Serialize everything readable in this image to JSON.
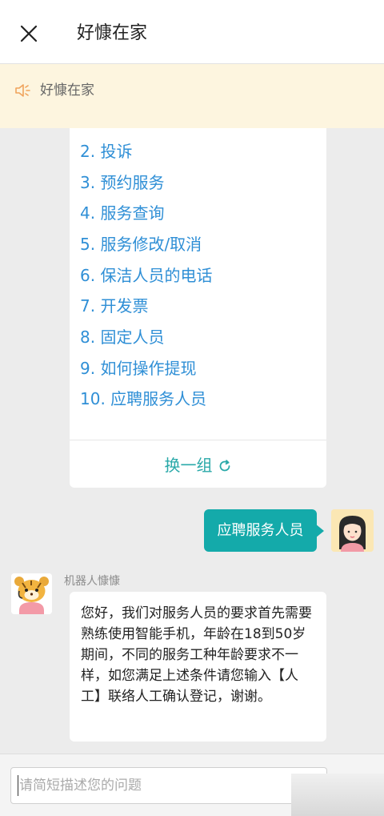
{
  "header": {
    "title": "好慷在家",
    "close_icon": "close-icon"
  },
  "notice": {
    "icon": "speaker-icon",
    "text": "好慷在家",
    "accent": "#f0a35c",
    "background": "#fdf5df"
  },
  "menu": {
    "items": [
      {
        "label": "2. 投诉"
      },
      {
        "label": "3. 预约服务"
      },
      {
        "label": "4. 服务查询"
      },
      {
        "label": "5. 服务修改/取消"
      },
      {
        "label": "6. 保洁人员的电话"
      },
      {
        "label": "7. 开发票"
      },
      {
        "label": "8. 固定人员"
      },
      {
        "label": "9. 如何操作提现"
      },
      {
        "label": "10. 应聘服务人员"
      }
    ],
    "refresh_label": "换一组",
    "refresh_icon": "refresh-icon",
    "link_color": "#2f8fd6"
  },
  "chat": {
    "user_message": "应聘服务人员",
    "bot_name": "机器人慷慷",
    "bot_message": "您好，我们对服务人员的要求首先需要熟练使用智能手机，年龄在18到50岁期间，不同的服务工种年龄要求不一样，如您满足上述条件请您输入【人工】联络人工确认登记，谢谢。",
    "user_bubble_color": "#14aaaa"
  },
  "input": {
    "placeholder": "请简短描述您的问题",
    "value": ""
  }
}
